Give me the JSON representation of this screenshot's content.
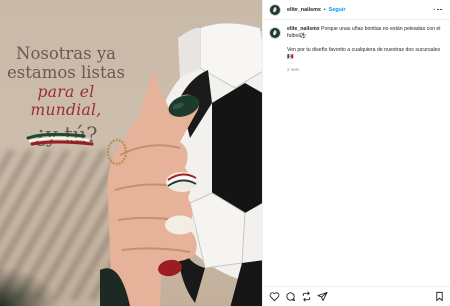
{
  "post": {
    "username": "elite_nailsmx",
    "separator": "•",
    "follow_label": "Seguir",
    "caption": {
      "text_line1": "Porque unas uñas bonitas no están peleadas con el futbol⚽",
      "text_line2": "Ven por tu diseño favorito a cualquiera de nuestras dos sucursales🇲🇽",
      "time": "2 sem"
    }
  },
  "image": {
    "line1": "Nosotras ya",
    "line2": "estamos listas",
    "line3": "para el mundial,",
    "line4": "¿y tú?"
  },
  "icons": [
    "more-icon",
    "heart-icon",
    "comment-icon",
    "repost-icon",
    "share-icon",
    "bookmark-icon"
  ],
  "colors": {
    "follow": "#0095f6",
    "headline": "#6b5a4e",
    "accent_red": "#9a2f2a",
    "nail_green": "#1e3a2c",
    "nail_red": "#9b1c22"
  }
}
